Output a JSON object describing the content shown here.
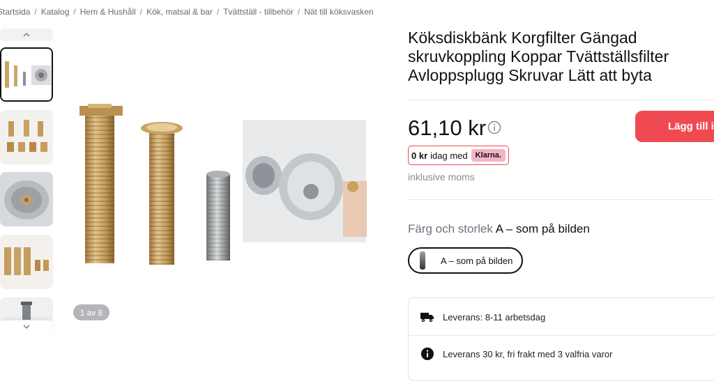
{
  "breadcrumb": [
    "Startsida",
    "Katalog",
    "Hem & Hushåll",
    "Kök, matsal & bar",
    "Tvättställ - tillbehör",
    "Nät till köksvasken"
  ],
  "gallery": {
    "counter": "1 av 8"
  },
  "product": {
    "title": "Köksdiskbänk Korgfilter Gängad skruvkoppling Koppar Tvättställsfilter Avloppsplugg Skruvar Lätt att byta",
    "price": "61,10 kr",
    "add_to_cart": "Lägg till i",
    "klarna": {
      "amount": "0 kr",
      "text": "idag med",
      "brand": "Klarna."
    },
    "vat_note": "inklusive moms",
    "variant_label": "Färg och storlek",
    "variant_value": "A – som på bilden",
    "variant_option": "A – som på bilden"
  },
  "shipping": {
    "row1": "Leverans: 8-11  arbetsdag",
    "row2": "Leverans 30 kr, fri frakt med 3 valfria varor"
  },
  "colors": {
    "accent": "#ef4a52",
    "klarna_pink": "#f5b3c8"
  }
}
